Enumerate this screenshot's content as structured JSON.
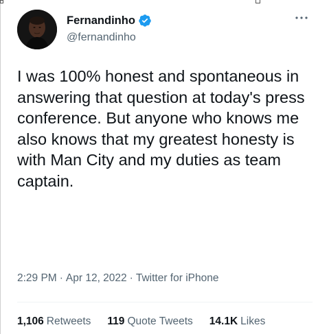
{
  "tweet": {
    "author": {
      "display_name": "Fernandinho",
      "handle": "@fernandinho",
      "verified": true
    },
    "more_icon": "more-horizontal-icon",
    "text": "I was 100% honest and spontaneous in answering that question at today's press conference. But anyone who knows me also knows that my greatest honesty is with Man City and my duties as team captain.",
    "time": "2:29 PM",
    "date": "Apr 12, 2022",
    "source": "Twitter for iPhone",
    "separator": "·",
    "stats": {
      "retweets_count": "1,106",
      "retweets_label": "Retweets",
      "quotes_count": "119",
      "quotes_label": "Quote Tweets",
      "likes_count": "14.1K",
      "likes_label": "Likes"
    }
  },
  "colors": {
    "text_primary": "#0f1419",
    "text_secondary": "#536471",
    "verified_blue": "#1d9bf0",
    "divider": "#eff3f4"
  }
}
